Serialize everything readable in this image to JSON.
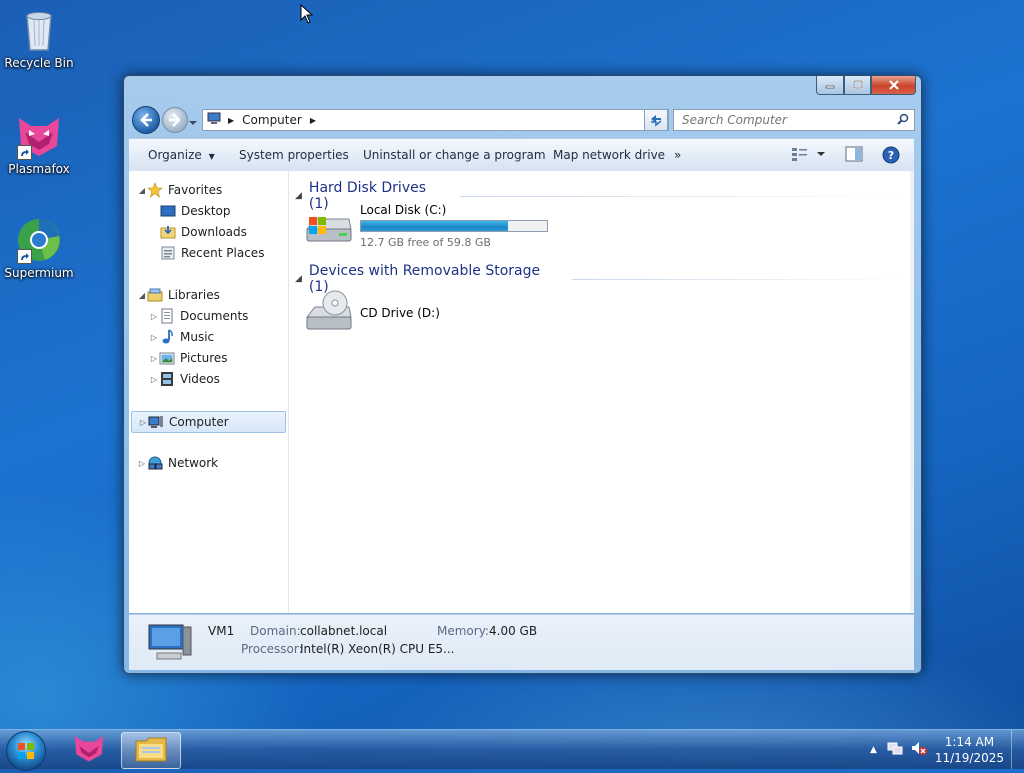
{
  "desktop": {
    "icons": [
      {
        "label": "Recycle Bin"
      },
      {
        "label": "Plasmafox"
      },
      {
        "label": "Supermium"
      }
    ]
  },
  "window": {
    "address": {
      "crumb": "Computer",
      "search_placeholder": "Search Computer"
    },
    "toolbar": {
      "organize": "Organize",
      "system_properties": "System properties",
      "uninstall": "Uninstall or change a program",
      "map_drive": "Map network drive",
      "more": "»"
    },
    "nav": {
      "favorites": "Favorites",
      "desktop": "Desktop",
      "downloads": "Downloads",
      "recent": "Recent Places",
      "libraries": "Libraries",
      "documents": "Documents",
      "music": "Music",
      "pictures": "Pictures",
      "videos": "Videos",
      "computer": "Computer",
      "network": "Network"
    },
    "groups": {
      "hdd": "Hard Disk Drives (1)",
      "removable": "Devices with Removable Storage (1)"
    },
    "drives": {
      "c": {
        "name": "Local Disk (C:)",
        "free": "12.7 GB free of 59.8 GB",
        "used_fraction": 0.79
      },
      "d": {
        "name": "CD Drive (D:)"
      }
    },
    "details": {
      "name": "VM1",
      "domain_label": "Domain:",
      "domain": "collabnet.local",
      "memory_label": "Memory:",
      "memory": "4.00 GB",
      "processor_label": "Processor:",
      "processor": "Intel(R) Xeon(R) CPU E5..."
    }
  },
  "taskbar": {
    "time": "1:14 AM",
    "date": "11/19/2025"
  },
  "colors": {
    "accent": "#1e3287",
    "bar_fill": "#1c86c4",
    "close_red": "#c9442a"
  }
}
